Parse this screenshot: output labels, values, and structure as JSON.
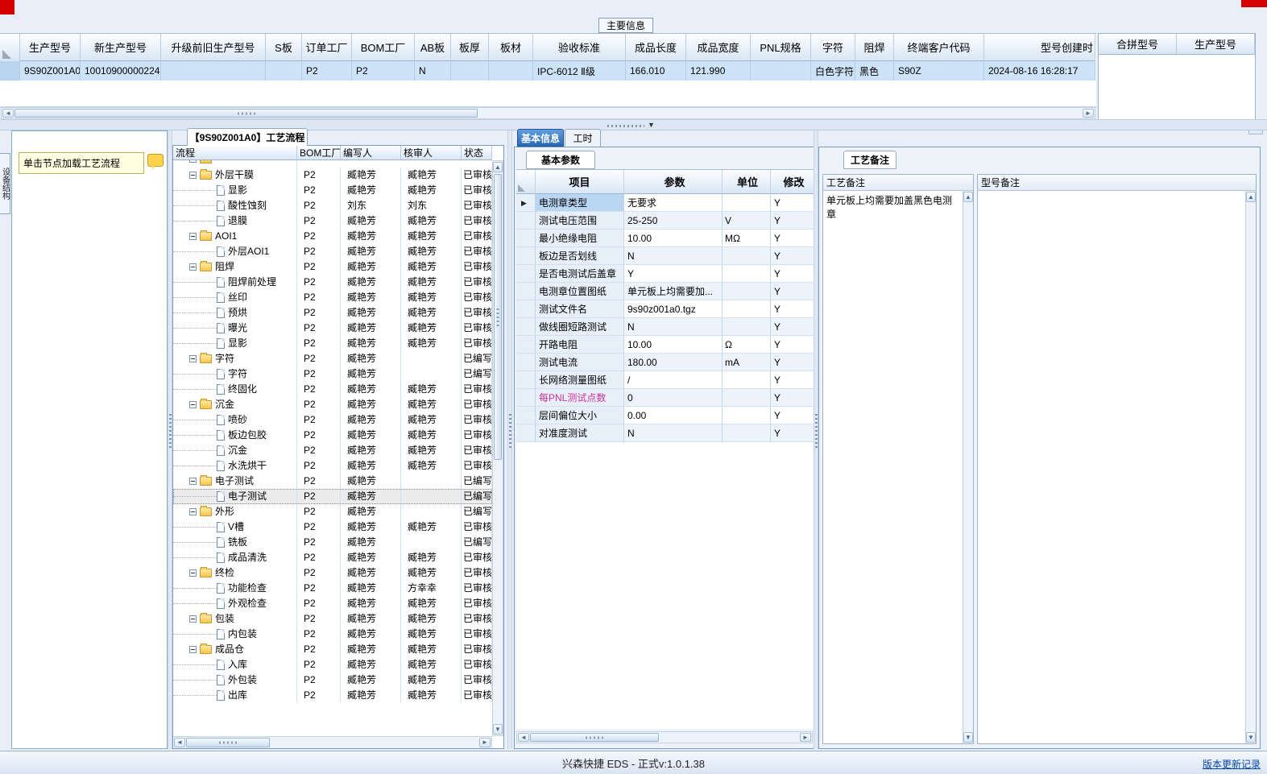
{
  "top_tab": {
    "label": "主要信息"
  },
  "main_table": {
    "columns": [
      "生产型号",
      "新生产型号",
      "升级前旧生产型号",
      "S板",
      "订单工厂",
      "BOM工厂",
      "AB板",
      "板厚",
      "板材",
      "验收标准",
      "成品长度",
      "成品宽度",
      "PNL规格",
      "字符",
      "阻焊",
      "终端客户代码",
      "型号创建时"
    ],
    "row": [
      "9S90Z001A0",
      "10010900000224",
      "",
      "",
      "P2",
      "P2",
      "N",
      "",
      "",
      "IPC-6012 Ⅱ级",
      "166.010",
      "121.990",
      "",
      "白色字符",
      "黑色",
      "S90Z",
      "2024-08-16 16:28:17"
    ]
  },
  "side_table": {
    "columns": [
      "合拼型号",
      "生产型号"
    ]
  },
  "left_tab": {
    "label": "设备结构"
  },
  "node_panel": {
    "tooltip": "单击节点加载工艺流程"
  },
  "tree": {
    "tab_title": "【9S90Z001A0】工艺流程",
    "columns": [
      "流程",
      "BOM工厂",
      "编写人",
      "核审人",
      "状态"
    ],
    "rows": [
      {
        "type": "folder",
        "label": "外层干膜",
        "bom": "P2",
        "writer": "臧艳芳",
        "reviewer": "臧艳芳",
        "status": "已审核"
      },
      {
        "type": "doc",
        "label": "显影",
        "bom": "P2",
        "writer": "臧艳芳",
        "reviewer": "臧艳芳",
        "status": "已审核"
      },
      {
        "type": "doc",
        "label": "酸性蚀刻",
        "bom": "P2",
        "writer": "刘东",
        "reviewer": "刘东",
        "status": "已审核"
      },
      {
        "type": "doc",
        "label": "退膜",
        "bom": "P2",
        "writer": "臧艳芳",
        "reviewer": "臧艳芳",
        "status": "已审核"
      },
      {
        "type": "folder",
        "label": "AOI1",
        "bom": "P2",
        "writer": "臧艳芳",
        "reviewer": "臧艳芳",
        "status": "已审核"
      },
      {
        "type": "doc",
        "label": "外层AOI1",
        "bom": "P2",
        "writer": "臧艳芳",
        "reviewer": "臧艳芳",
        "status": "已审核"
      },
      {
        "type": "folder",
        "label": "阻焊",
        "bom": "P2",
        "writer": "臧艳芳",
        "reviewer": "臧艳芳",
        "status": "已审核"
      },
      {
        "type": "doc",
        "label": "阻焊前处理",
        "bom": "P2",
        "writer": "臧艳芳",
        "reviewer": "臧艳芳",
        "status": "已审核"
      },
      {
        "type": "doc",
        "label": "丝印",
        "bom": "P2",
        "writer": "臧艳芳",
        "reviewer": "臧艳芳",
        "status": "已审核"
      },
      {
        "type": "doc",
        "label": "预烘",
        "bom": "P2",
        "writer": "臧艳芳",
        "reviewer": "臧艳芳",
        "status": "已审核"
      },
      {
        "type": "doc",
        "label": "曝光",
        "bom": "P2",
        "writer": "臧艳芳",
        "reviewer": "臧艳芳",
        "status": "已审核"
      },
      {
        "type": "doc",
        "label": "显影",
        "bom": "P2",
        "writer": "臧艳芳",
        "reviewer": "臧艳芳",
        "status": "已审核"
      },
      {
        "type": "folder",
        "label": "字符",
        "bom": "P2",
        "writer": "臧艳芳",
        "reviewer": "",
        "status": "已编写"
      },
      {
        "type": "doc",
        "label": "字符",
        "bom": "P2",
        "writer": "臧艳芳",
        "reviewer": "",
        "status": "已编写"
      },
      {
        "type": "doc",
        "label": "终固化",
        "bom": "P2",
        "writer": "臧艳芳",
        "reviewer": "臧艳芳",
        "status": "已审核"
      },
      {
        "type": "folder",
        "label": "沉金",
        "bom": "P2",
        "writer": "臧艳芳",
        "reviewer": "臧艳芳",
        "status": "已审核"
      },
      {
        "type": "doc",
        "label": "喷砂",
        "bom": "P2",
        "writer": "臧艳芳",
        "reviewer": "臧艳芳",
        "status": "已审核"
      },
      {
        "type": "doc",
        "label": "板边包胶",
        "bom": "P2",
        "writer": "臧艳芳",
        "reviewer": "臧艳芳",
        "status": "已审核"
      },
      {
        "type": "doc",
        "label": "沉金",
        "bom": "P2",
        "writer": "臧艳芳",
        "reviewer": "臧艳芳",
        "status": "已审核"
      },
      {
        "type": "doc",
        "label": "水洗烘干",
        "bom": "P2",
        "writer": "臧艳芳",
        "reviewer": "臧艳芳",
        "status": "已审核"
      },
      {
        "type": "folder",
        "label": "电子测试",
        "bom": "P2",
        "writer": "臧艳芳",
        "reviewer": "",
        "status": "已编写"
      },
      {
        "type": "doc",
        "label": "电子测试",
        "bom": "P2",
        "writer": "臧艳芳",
        "reviewer": "",
        "status": "已编写",
        "selected": true
      },
      {
        "type": "folder",
        "label": "外形",
        "bom": "P2",
        "writer": "臧艳芳",
        "reviewer": "",
        "status": "已编写"
      },
      {
        "type": "doc",
        "label": "V槽",
        "bom": "P2",
        "writer": "臧艳芳",
        "reviewer": "臧艳芳",
        "status": "已审核"
      },
      {
        "type": "doc",
        "label": "铣板",
        "bom": "P2",
        "writer": "臧艳芳",
        "reviewer": "",
        "status": "已编写"
      },
      {
        "type": "doc",
        "label": "成品清洗",
        "bom": "P2",
        "writer": "臧艳芳",
        "reviewer": "臧艳芳",
        "status": "已审核"
      },
      {
        "type": "folder",
        "label": "终检",
        "bom": "P2",
        "writer": "臧艳芳",
        "reviewer": "臧艳芳",
        "status": "已审核"
      },
      {
        "type": "doc",
        "label": "功能检查",
        "bom": "P2",
        "writer": "臧艳芳",
        "reviewer": "方幸幸",
        "status": "已审核"
      },
      {
        "type": "doc",
        "label": "外观检查",
        "bom": "P2",
        "writer": "臧艳芳",
        "reviewer": "臧艳芳",
        "status": "已审核"
      },
      {
        "type": "folder",
        "label": "包装",
        "bom": "P2",
        "writer": "臧艳芳",
        "reviewer": "臧艳芳",
        "status": "已审核"
      },
      {
        "type": "doc",
        "label": "内包装",
        "bom": "P2",
        "writer": "臧艳芳",
        "reviewer": "臧艳芳",
        "status": "已审核"
      },
      {
        "type": "folder",
        "label": "成品仓",
        "bom": "P2",
        "writer": "臧艳芳",
        "reviewer": "臧艳芳",
        "status": "已审核"
      },
      {
        "type": "doc",
        "label": "入库",
        "bom": "P2",
        "writer": "臧艳芳",
        "reviewer": "臧艳芳",
        "status": "已审核"
      },
      {
        "type": "doc",
        "label": "外包装",
        "bom": "P2",
        "writer": "臧艳芳",
        "reviewer": "臧艳芳",
        "status": "已审核"
      },
      {
        "type": "doc",
        "label": "出库",
        "bom": "P2",
        "writer": "臧艳芳",
        "reviewer": "臧艳芳",
        "status": "已审核"
      }
    ]
  },
  "params": {
    "tabs": [
      {
        "label": "基本信息",
        "selected": true
      },
      {
        "label": "工时",
        "selected": false
      }
    ],
    "subtab": "基本参数",
    "columns": [
      "项目",
      "参数",
      "单位",
      "修改"
    ],
    "rows": [
      {
        "item": "电测章类型",
        "value": "无要求",
        "unit": "",
        "modify": "Y",
        "selected": true
      },
      {
        "item": "测试电压范围",
        "value": "25-250",
        "unit": "V",
        "modify": "Y"
      },
      {
        "item": "最小绝缘电阻",
        "value": "10.00",
        "unit": "MΩ",
        "modify": "Y"
      },
      {
        "item": "板边是否划线",
        "value": "N",
        "unit": "",
        "modify": "Y"
      },
      {
        "item": "是否电测试后盖章",
        "value": "Y",
        "unit": "",
        "modify": "Y"
      },
      {
        "item": "电测章位置图纸",
        "value": "单元板上均需要加...",
        "unit": "",
        "modify": "Y"
      },
      {
        "item": "测试文件名",
        "value": "9s90z001a0.tgz",
        "unit": "",
        "modify": "Y"
      },
      {
        "item": "做线圈短路测试",
        "value": "N",
        "unit": "",
        "modify": "Y"
      },
      {
        "item": "开路电阻",
        "value": "10.00",
        "unit": "Ω",
        "modify": "Y"
      },
      {
        "item": "测试电流",
        "value": "180.00",
        "unit": "mA",
        "modify": "Y"
      },
      {
        "item": "长网络测量图纸",
        "value": "/",
        "unit": "",
        "modify": "Y"
      },
      {
        "item": "每PNL测试点数",
        "value": "0",
        "unit": "",
        "modify": "Y",
        "pink": true
      },
      {
        "item": "层间偏位大小",
        "value": "0.00",
        "unit": "",
        "modify": "Y"
      },
      {
        "item": "对准度测试",
        "value": "N",
        "unit": "",
        "modify": "Y"
      }
    ]
  },
  "notes": {
    "tab": "工艺备注",
    "left_header": "工艺备注",
    "right_header": "型号备注",
    "left_content": "单元板上均需要加盖黑色电测章",
    "right_content": ""
  },
  "status_bar": {
    "center": "兴森快捷 EDS - 正式v:1.0.1.38",
    "link": "版本更新记录"
  },
  "colors": {
    "accent_tab": "#2a69b4",
    "pink_item": "#cc3399",
    "selected_row": "#cde3f8"
  }
}
